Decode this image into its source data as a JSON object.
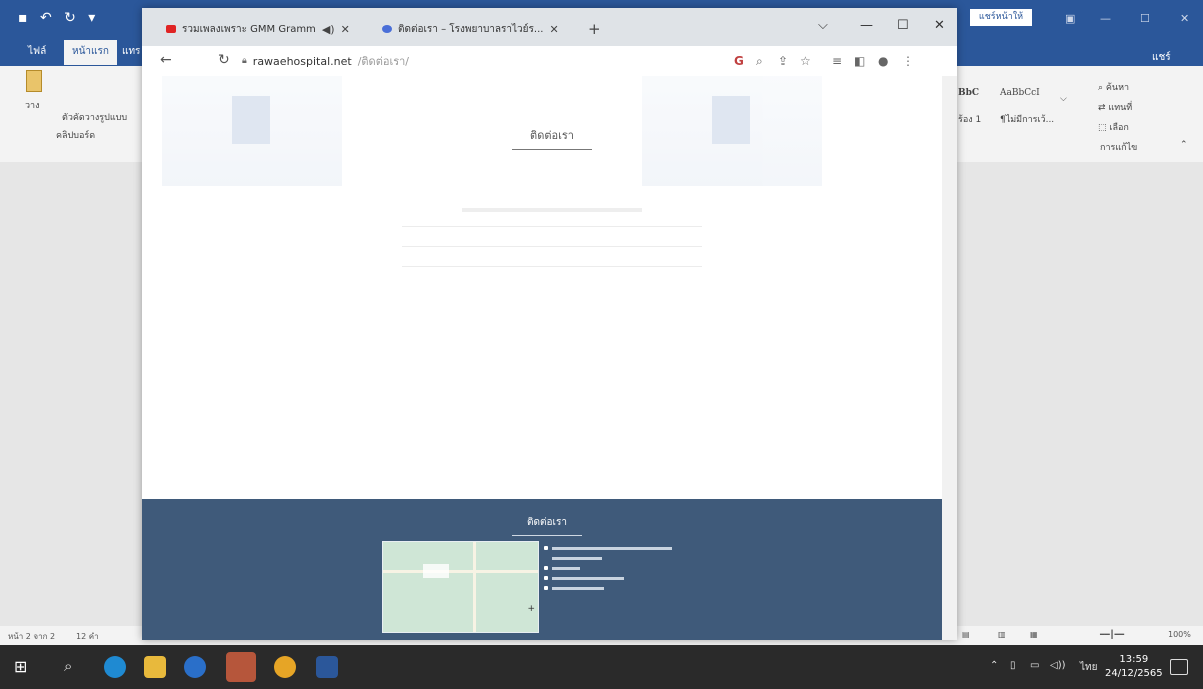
{
  "word": {
    "tabs": {
      "file": "ไฟล์",
      "home": "หน้าแรก",
      "insert": "แทร"
    },
    "share_button": "แชร์หน้าให้",
    "share_label": "แชร์",
    "ribbon": {
      "paste_label": "วาง",
      "format_painter": "ตัวคัดวางรูปแบบ",
      "clipboard_group": "คลิปบอร์ด",
      "style_normal": "BbC",
      "style_no_spacing": "AaBbCcI",
      "style_heading_1": "ร้อง 1",
      "style_hint": "¶ไม่มีการเว้...",
      "find": "ค้นหา",
      "replace": "แทนที่",
      "select": "เลือก",
      "editing_group": "การแก้ไข"
    },
    "status": {
      "page": "หน้า 2 จาก 2",
      "words": "12 คำ",
      "zoom": "100%"
    }
  },
  "chrome": {
    "tabs": [
      {
        "label": "รวมเพลงเพราะ GMM Gramm",
        "favicon_color": "#e02424"
      },
      {
        "label": "ติดต่อเรา – โรงพยาบาลราไวย์ร...",
        "favicon_color": "#4a6fd8"
      }
    ],
    "url_domain": "rawaehospital.net",
    "url_path": "/ติดต่อเรา/",
    "page": {
      "heading": "ติดต่อเรา",
      "footer_heading": "ติดต่อเรา"
    }
  },
  "taskbar": {
    "language": "ไทย",
    "time": "13:59",
    "date": "24/12/2565"
  }
}
